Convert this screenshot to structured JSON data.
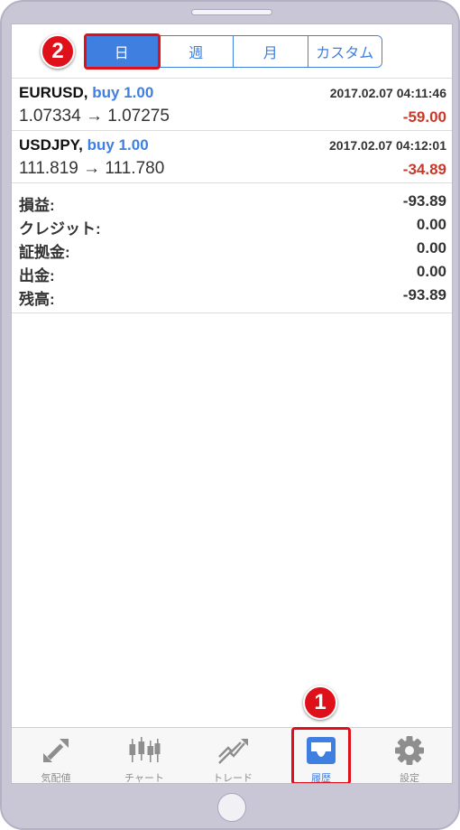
{
  "periods": [
    {
      "label": "日",
      "active": true
    },
    {
      "label": "週",
      "active": false
    },
    {
      "label": "月",
      "active": false
    },
    {
      "label": "カスタム",
      "active": false
    }
  ],
  "trades": [
    {
      "symbol": "EURUSD,",
      "side": "buy 1.00",
      "time": "2017.02.07 04:11:46",
      "prices": "1.07334 → 1.07275",
      "profit": "-59.00"
    },
    {
      "symbol": "USDJPY,",
      "side": "buy 1.00",
      "time": "2017.02.07 04:12:01",
      "prices": "111.819 → 111.780",
      "profit": "-34.89"
    }
  ],
  "summary": [
    {
      "label": "損益:",
      "value": "-93.89"
    },
    {
      "label": "クレジット:",
      "value": "0.00"
    },
    {
      "label": "証拠金:",
      "value": "0.00"
    },
    {
      "label": "出金:",
      "value": "0.00"
    },
    {
      "label": "残高:",
      "value": "-93.89"
    }
  ],
  "tabs": [
    {
      "label": "気配値",
      "icon": "quotes-icon"
    },
    {
      "label": "チャート",
      "icon": "chart-icon"
    },
    {
      "label": "トレード",
      "icon": "trade-icon"
    },
    {
      "label": "履歴",
      "icon": "history-icon",
      "active": true
    },
    {
      "label": "設定",
      "icon": "gear-icon"
    }
  ],
  "callouts": {
    "one": "1",
    "two": "2"
  },
  "colors": {
    "accent": "#3e7fe0",
    "loss": "#c8392b",
    "callout": "#e0101b"
  }
}
